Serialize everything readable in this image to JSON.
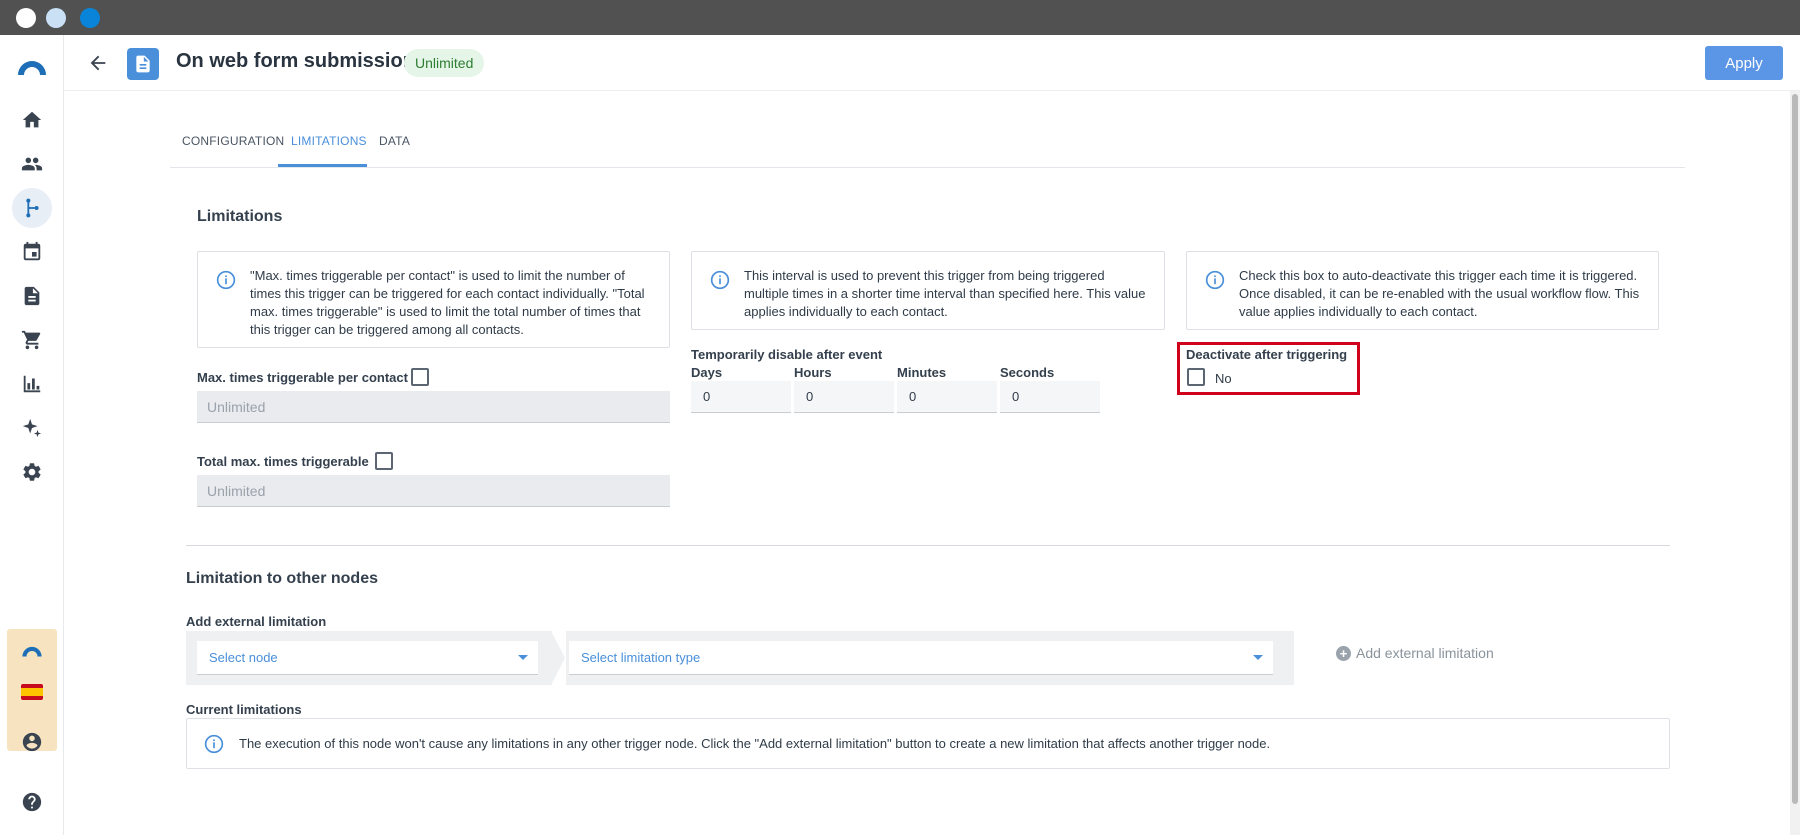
{
  "window": {
    "traffic_lights": [
      "#ffffff",
      "#c9e0f5",
      "#0a84d8"
    ]
  },
  "sidebar": {
    "items": [
      {
        "icon": "home-icon"
      },
      {
        "icon": "contacts-icon"
      },
      {
        "icon": "workflow-icon",
        "active": true
      },
      {
        "icon": "calendar-icon"
      },
      {
        "icon": "document-icon"
      },
      {
        "icon": "cart-icon"
      },
      {
        "icon": "chart-icon"
      },
      {
        "icon": "sparkle-icon"
      },
      {
        "icon": "gear-icon"
      }
    ],
    "bottom_icons": [
      "account-icon",
      "help-icon"
    ]
  },
  "header": {
    "title": "On web form submission",
    "status_chip": "Unlimited",
    "apply_label": "Apply"
  },
  "tabs": [
    {
      "label": "CONFIGURATION"
    },
    {
      "label": "LIMITATIONS",
      "active": true
    },
    {
      "label": "DATA"
    }
  ],
  "limitations": {
    "title": "Limitations",
    "info_1": "\"Max. times triggerable per contact\" is used to limit the number of times this trigger can be triggered for each contact individually. \"Total max. times triggerable\" is used to limit the total number of times that this trigger can be triggered among all contacts.",
    "info_2": "This interval is used to prevent this trigger from being triggered multiple times in a shorter time interval than specified here. This value applies individually to each contact.",
    "info_3": "Check this box to auto-deactivate this trigger each time it is triggered. Once disabled, it can be re-enabled with the usual workflow flow. This value applies individually to each contact.",
    "max_per_contact_label": "Max. times triggerable per contact",
    "max_per_contact_value": "Unlimited",
    "total_max_label": "Total max. times triggerable",
    "total_max_value": "Unlimited",
    "temp_disable_label": "Temporarily disable after event",
    "days_label": "Days",
    "hours_label": "Hours",
    "minutes_label": "Minutes",
    "seconds_label": "Seconds",
    "days_value": "0",
    "hours_value": "0",
    "minutes_value": "0",
    "seconds_value": "0",
    "deactivate_label": "Deactivate after triggering",
    "deactivate_value": "No"
  },
  "other_nodes": {
    "title": "Limitation to other nodes",
    "add_external_label": "Add external limitation",
    "select_node_placeholder": "Select node",
    "select_type_placeholder": "Select limitation type",
    "add_external_button": "Add external limitation",
    "current_label": "Current limitations",
    "current_info": "The execution of this node won't cause any limitations in any other trigger node. Click the \"Add external limitation\" button to create a new limitation that affects another trigger node."
  },
  "colors": {
    "accent": "#4a8fd9",
    "apply_bg": "#5b95e5",
    "highlight": "#d0021b",
    "chip_bg": "#e5f5e8",
    "chip_text": "#2e7d32"
  }
}
